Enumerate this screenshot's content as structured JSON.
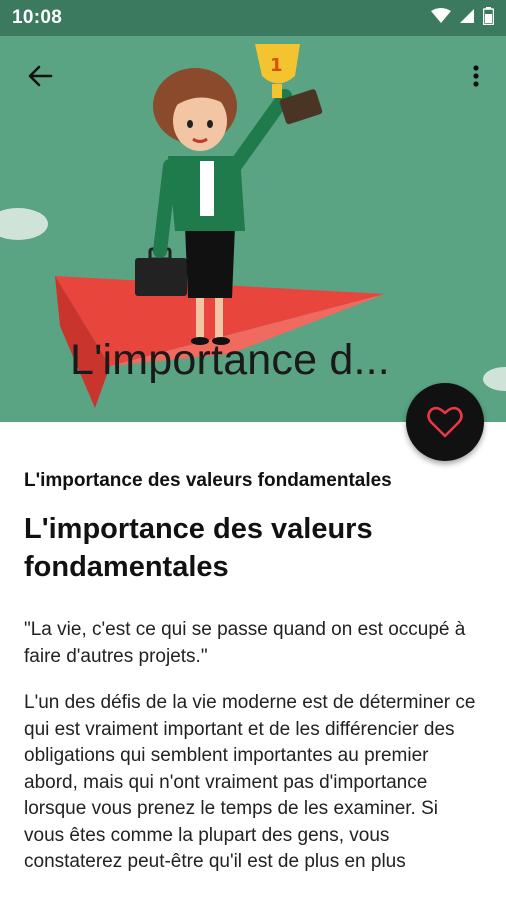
{
  "status_bar": {
    "time": "10:08",
    "icons": [
      "wifi-icon",
      "signal-icon",
      "battery-icon"
    ]
  },
  "toolbar": {
    "back_icon": "arrow-back-icon",
    "menu_icon": "more-vert-icon"
  },
  "hero": {
    "title": "L'importance d...",
    "illustration": "businesswoman-holding-trophy-on-paper-plane"
  },
  "fab": {
    "icon": "heart-outline-icon"
  },
  "article": {
    "subtitle": "L'importance des valeurs fondamentales",
    "heading": "L'importance des valeurs fondamentales",
    "quote": "\"La vie, c'est ce qui se passe quand on est occupé à faire d'autres projets.\"",
    "paragraph": "L'un des défis de la vie moderne est de déterminer ce qui est vraiment important et de les différencier des obligations qui semblent importantes au premier abord, mais qui n'ont vraiment pas d'importance lorsque vous prenez le temps de les examiner. Si vous êtes comme la plupart des gens, vous constaterez peut-être qu'il est de plus en plus"
  },
  "colors": {
    "status_bar": "#3b7a5e",
    "hero_bg": "#5aa383",
    "fab_bg": "#111111",
    "heart": "#e53946",
    "plane": "#e8453c"
  }
}
